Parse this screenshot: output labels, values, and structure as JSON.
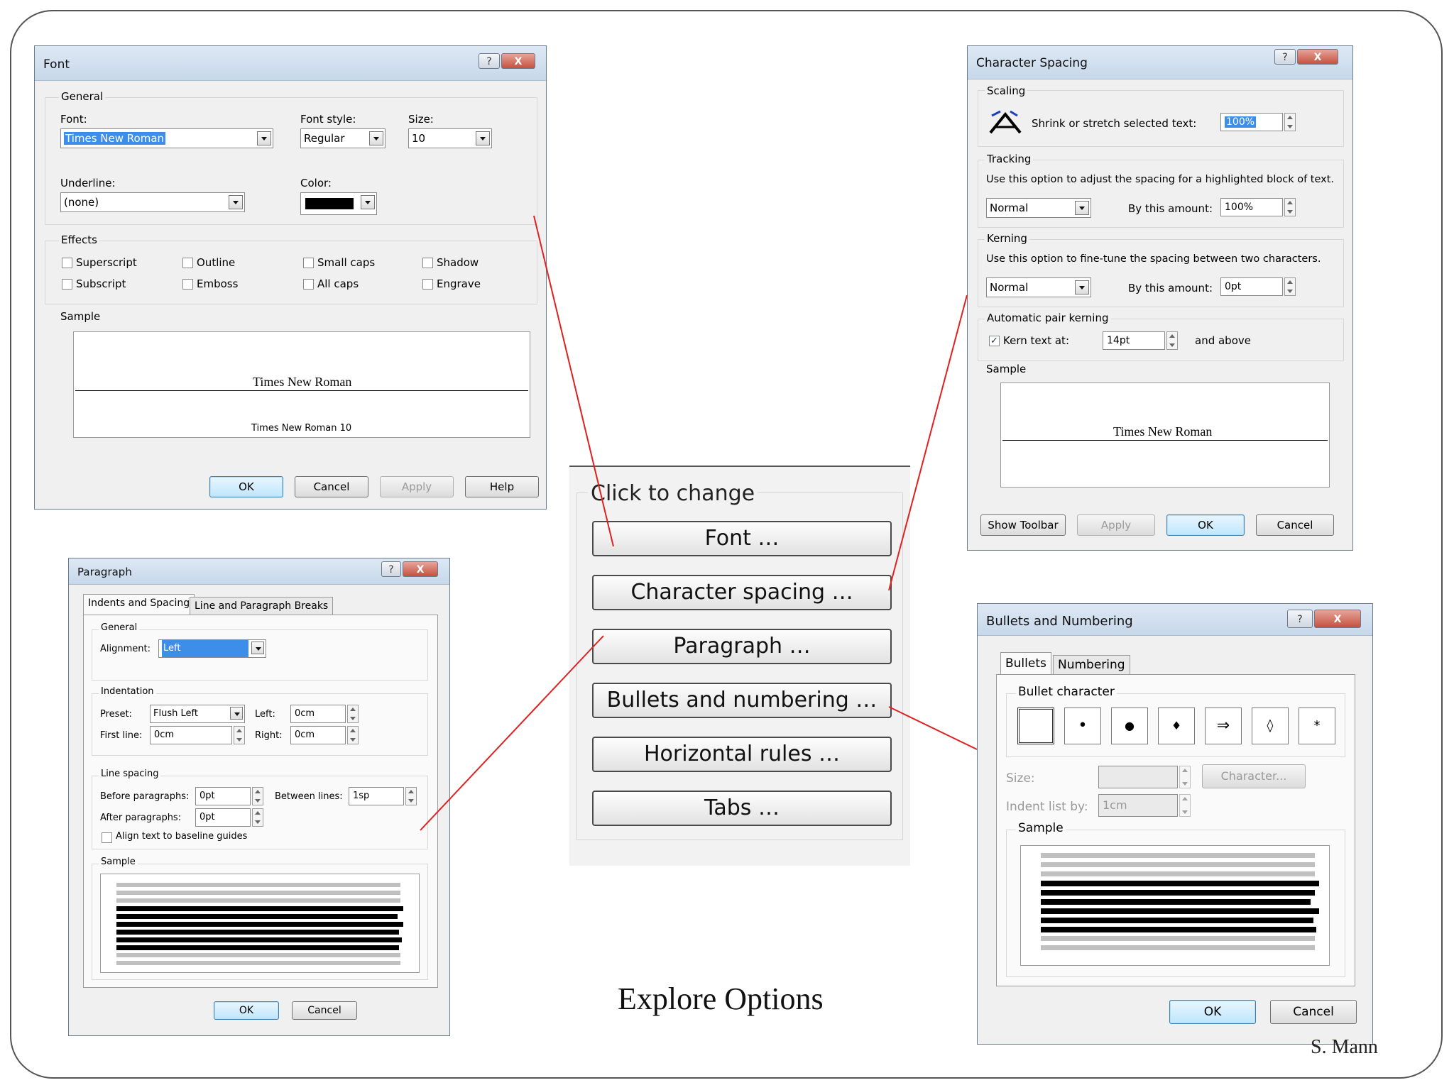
{
  "slide": {
    "title": "Explore Options",
    "author": "S. Mann"
  },
  "center_panel": {
    "heading": "Click to change",
    "buttons": [
      "Font …",
      "Character spacing …",
      "Paragraph …",
      "Bullets and numbering …",
      "Horizontal rules …",
      "Tabs …"
    ]
  },
  "font_dialog": {
    "title": "Font",
    "help_button": "?",
    "close_button": "X",
    "general_label": "General",
    "font_label": "Font:",
    "font_value": "Times New Roman",
    "font_style_label": "Font style:",
    "font_style_value": "Regular",
    "size_label": "Size:",
    "size_value": "10",
    "underline_label": "Underline:",
    "underline_value": "(none)",
    "color_label": "Color:",
    "effects_label": "Effects",
    "effects": [
      "Superscript",
      "Outline",
      "Small caps",
      "Shadow",
      "Subscript",
      "Emboss",
      "All caps",
      "Engrave"
    ],
    "sample_label": "Sample",
    "sample_text": "Times New Roman",
    "sample_caption": "Times New Roman 10",
    "buttons": {
      "ok": "OK",
      "cancel": "Cancel",
      "apply": "Apply",
      "help": "Help"
    }
  },
  "char_spacing_dialog": {
    "title": "Character Spacing",
    "help_button": "?",
    "close_button": "X",
    "scaling_label": "Scaling",
    "scaling_text": "Shrink or stretch selected text:",
    "scaling_value": "100%",
    "tracking_label": "Tracking",
    "tracking_desc": "Use this option to adjust the spacing for a highlighted block of text.",
    "tracking_mode": "Normal",
    "tracking_amount_label": "By this amount:",
    "tracking_amount": "100%",
    "kerning_label": "Kerning",
    "kerning_desc": "Use this option to fine-tune the spacing between two characters.",
    "kerning_mode": "Normal",
    "kerning_amount_label": "By this amount:",
    "kerning_amount": "0pt",
    "auto_kerning_label": "Automatic pair kerning",
    "kern_text_label": "Kern text at:",
    "kern_value": "14pt",
    "kern_suffix": "and above",
    "sample_label": "Sample",
    "sample_text": "Times New Roman",
    "buttons": {
      "show_toolbar": "Show Toolbar",
      "apply": "Apply",
      "ok": "OK",
      "cancel": "Cancel"
    }
  },
  "paragraph_dialog": {
    "title": "Paragraph",
    "help_button": "?",
    "close_button": "X",
    "tabs": [
      "Indents and Spacing",
      "Line and Paragraph Breaks"
    ],
    "general_label": "General",
    "alignment_label": "Alignment:",
    "alignment_value": "Left",
    "indentation_label": "Indentation",
    "preset_label": "Preset:",
    "preset_value": "Flush Left",
    "left_label": "Left:",
    "left_value": "0cm",
    "first_line_label": "First line:",
    "first_line_value": "0cm",
    "right_label": "Right:",
    "right_value": "0cm",
    "line_spacing_label": "Line spacing",
    "before_label": "Before paragraphs:",
    "before_value": "0pt",
    "between_label": "Between lines:",
    "between_value": "1sp",
    "after_label": "After paragraphs:",
    "after_value": "0pt",
    "align_baseline_label": "Align text to baseline guides",
    "sample_label": "Sample",
    "buttons": {
      "ok": "OK",
      "cancel": "Cancel"
    }
  },
  "bullets_dialog": {
    "title": "Bullets and Numbering",
    "help_button": "?",
    "close_button": "X",
    "tabs": [
      "Bullets",
      "Numbering"
    ],
    "bullet_character_label": "Bullet character",
    "bullet_characters": [
      "",
      "•",
      "●",
      "♦",
      "⇒",
      "◊",
      "*"
    ],
    "size_label": "Size:",
    "character_button": "Character...",
    "indent_label": "Indent list by:",
    "indent_value": "1cm",
    "sample_label": "Sample",
    "buttons": {
      "ok": "OK",
      "cancel": "Cancel"
    }
  },
  "colors": {
    "connector_line": "#e02020",
    "selection": "#3d8ee8"
  }
}
